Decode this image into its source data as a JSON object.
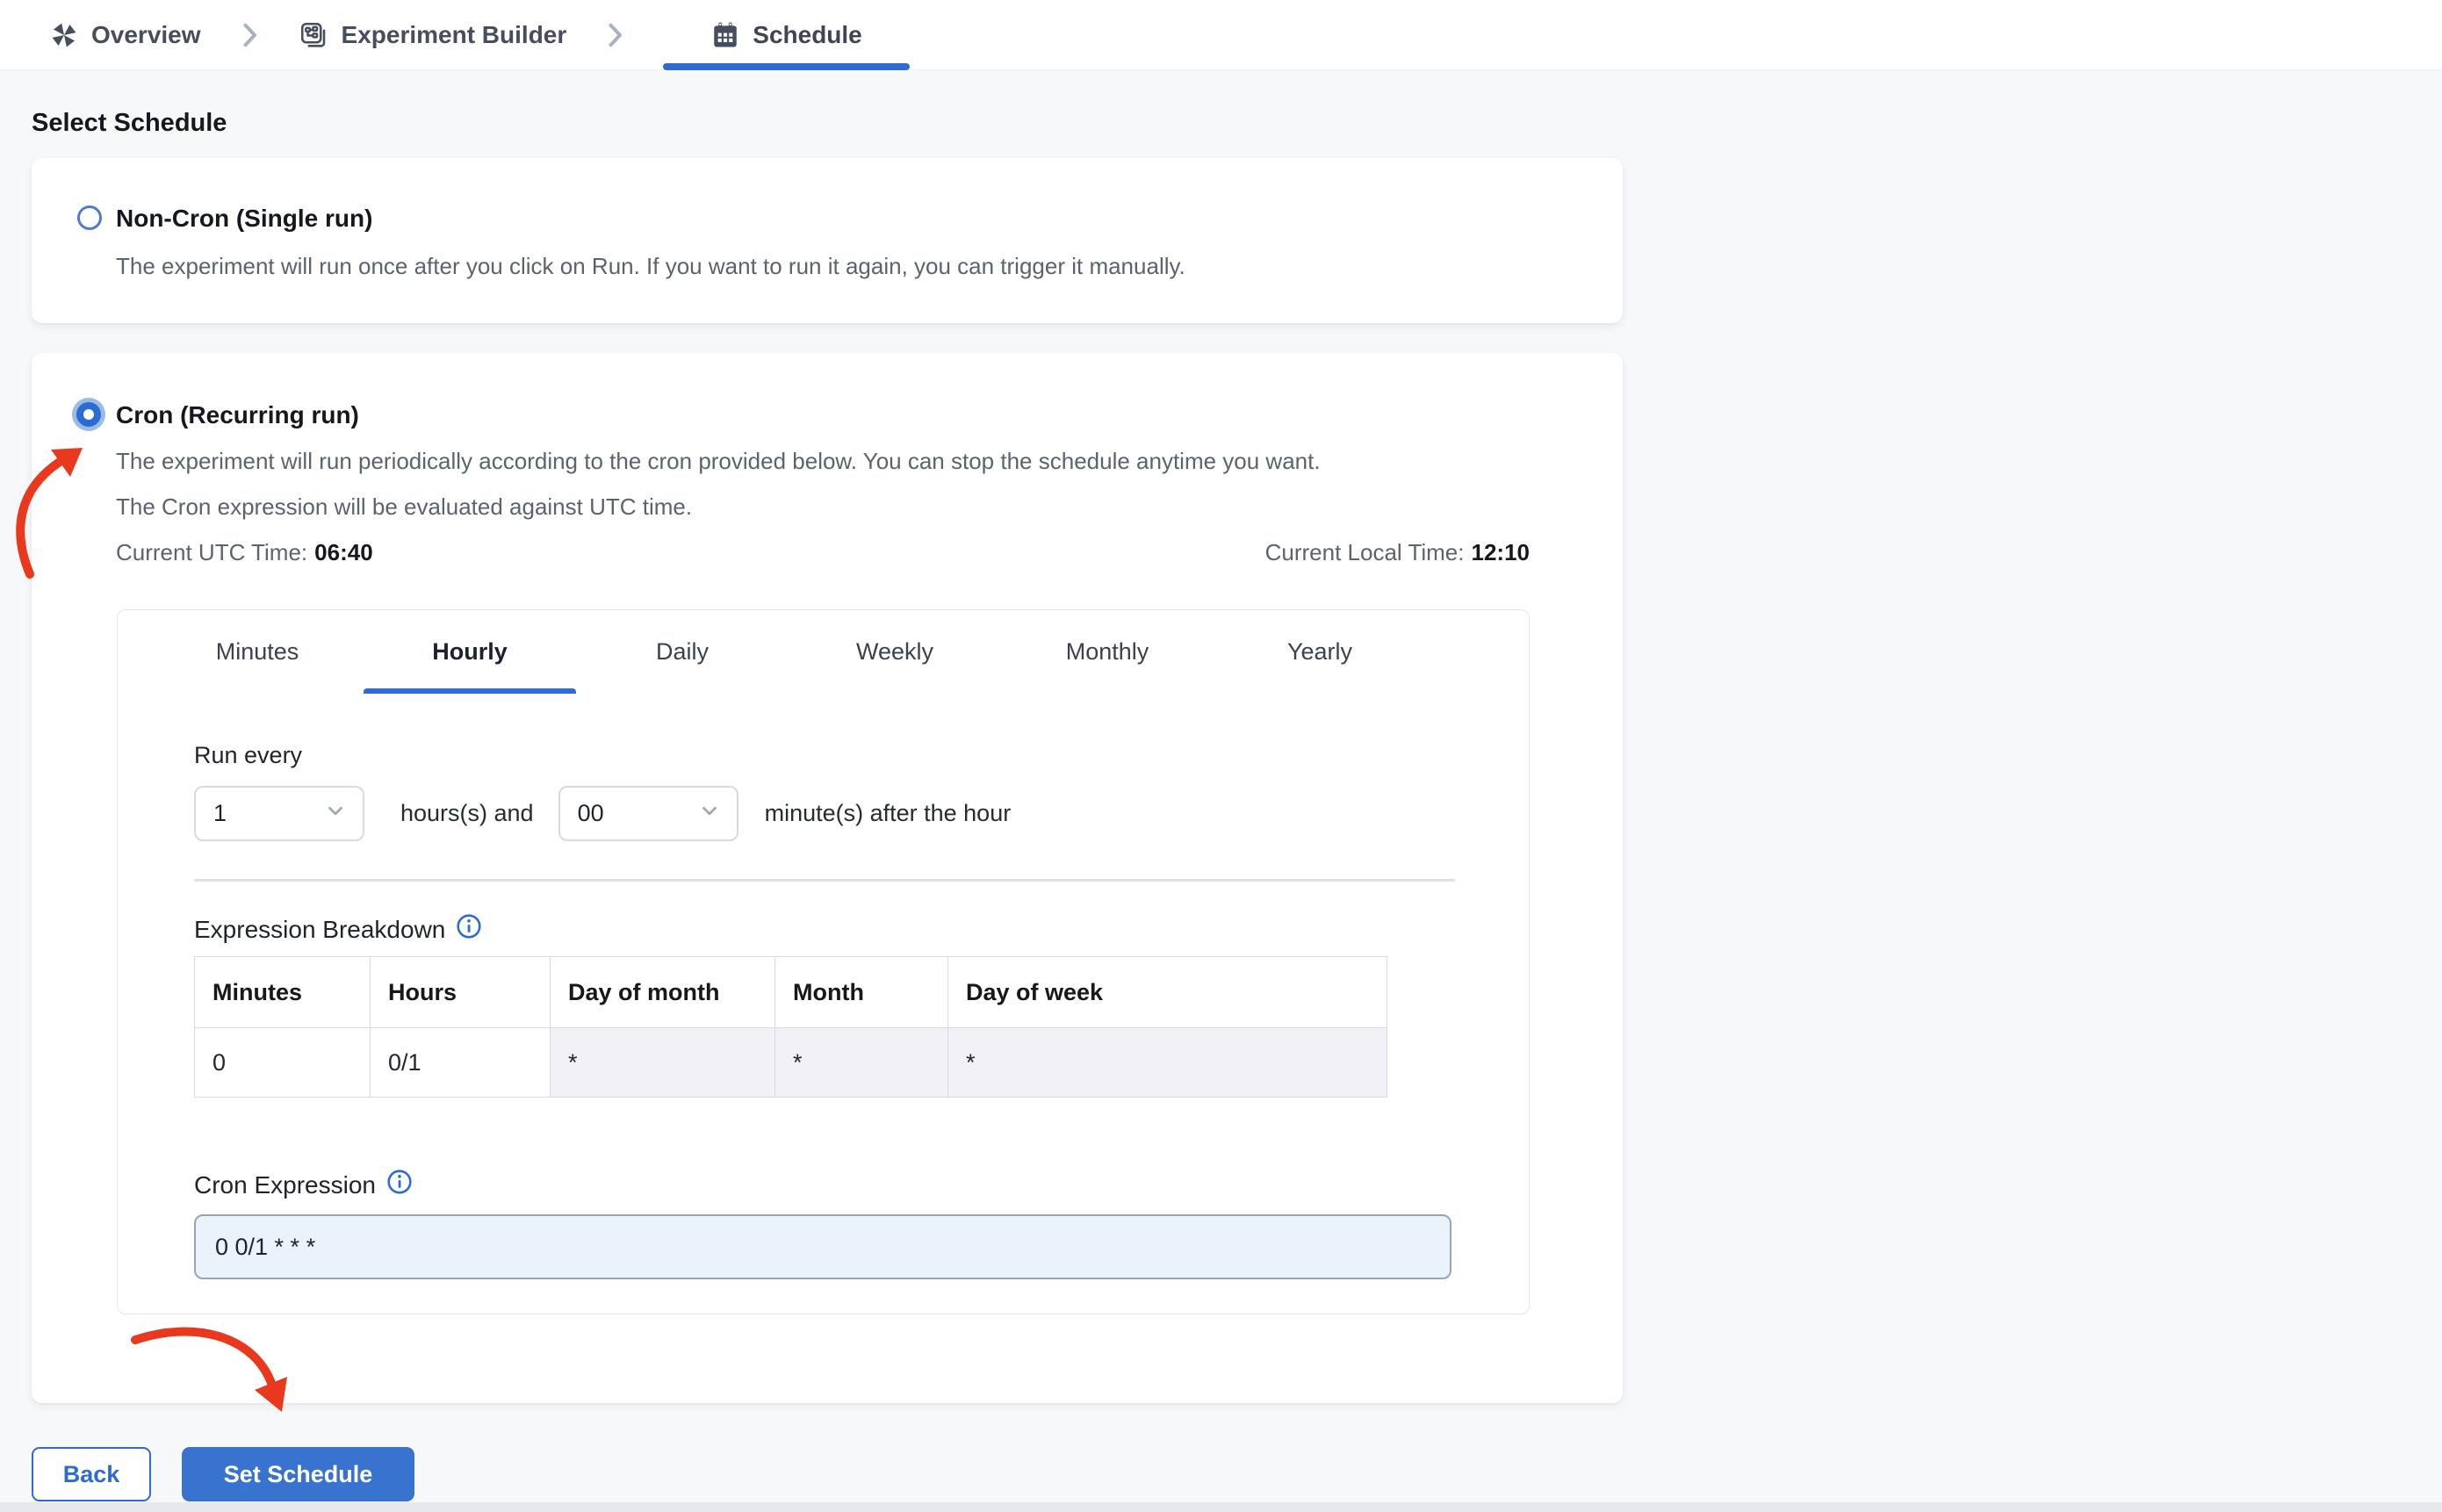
{
  "breadcrumb": {
    "overview": "Overview",
    "experiment_builder": "Experiment Builder",
    "schedule": "Schedule"
  },
  "heading": "Select Schedule",
  "non_cron": {
    "title": "Non-Cron (Single run)",
    "description": "The experiment will run once after you click on Run. If you want to run it again, you can trigger it manually."
  },
  "cron": {
    "title": "Cron (Recurring run)",
    "description_1": "The experiment will run periodically according to the cron provided below. You can stop the schedule anytime you want.",
    "description_2": "The Cron expression will be evaluated against UTC time.",
    "utc_time_label": "Current UTC Time:",
    "utc_time_value": "06:40",
    "local_time_label": "Current Local Time:",
    "local_time_value": "12:10"
  },
  "tabs": {
    "items": [
      "Minutes",
      "Hourly",
      "Daily",
      "Weekly",
      "Monthly",
      "Yearly"
    ],
    "active": "Hourly"
  },
  "hourly_form": {
    "run_every_label": "Run every",
    "hours_value": "1",
    "hours_label": "hours(s) and",
    "minutes_value": "00",
    "minutes_label": "minute(s) after the hour"
  },
  "expression_breakdown": {
    "label": "Expression Breakdown",
    "columns": [
      "Minutes",
      "Hours",
      "Day of month",
      "Month",
      "Day of week"
    ],
    "values": [
      "0",
      "0/1",
      "*",
      "*",
      "*"
    ]
  },
  "cron_expression": {
    "label": "Cron Expression",
    "value": "0 0/1 * * *"
  },
  "actions": {
    "back": "Back",
    "set_schedule": "Set Schedule"
  },
  "colors": {
    "accent_blue": "#2e6cd3",
    "button_blue": "#3874cf",
    "annotation_red": "#e8391f"
  }
}
